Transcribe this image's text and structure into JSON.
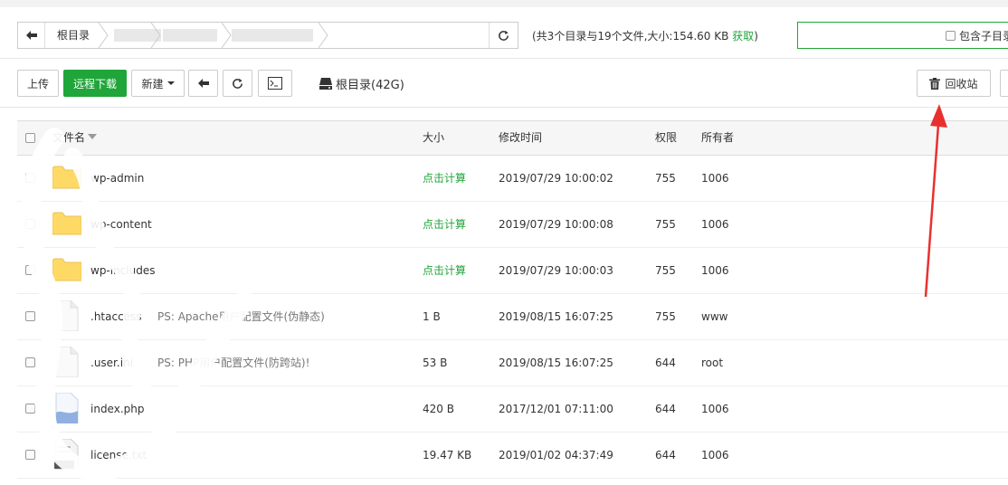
{
  "breadcrumb": {
    "root_label": "根目录"
  },
  "summary": {
    "text": "(共3个目录与19个文件,大小:154.60 KB ",
    "get_label": "获取",
    "close_paren": ")"
  },
  "search": {
    "include_sub_label": "包含子目录"
  },
  "toolbar": {
    "upload_label": "上传",
    "remote_download_label": "远程下载",
    "new_label": "新建",
    "disk_label": "根目录(42G)",
    "recycle_label": "回收站"
  },
  "table": {
    "columns": {
      "name": "文件名",
      "size": "大小",
      "mtime": "修改时间",
      "perm": "权限",
      "owner": "所有者"
    },
    "rows": [
      {
        "name": "wp-admin",
        "size": "点击计算",
        "mtime": "2019/07/29 10:00:02",
        "perm": "755",
        "owner": "1006",
        "type": "folder"
      },
      {
        "name": "wp-content",
        "size": "点击计算",
        "mtime": "2019/07/29 10:00:08",
        "perm": "755",
        "owner": "1006",
        "type": "folder"
      },
      {
        "name": "wp-includes",
        "size": "点击计算",
        "mtime": "2019/07/29 10:00:03",
        "perm": "755",
        "owner": "1006",
        "type": "folder"
      },
      {
        "name": ".htaccess",
        "note": "PS: Apache用户配置文件(伪静态)",
        "size": "1 B",
        "mtime": "2019/08/15 16:07:25",
        "perm": "755",
        "owner": "www",
        "type": "file"
      },
      {
        "name": ".user.ini",
        "note": "PS: PHP用户配置文件(防跨站)!",
        "size": "53 B",
        "mtime": "2019/08/15 16:07:25",
        "perm": "644",
        "owner": "root",
        "type": "file"
      },
      {
        "name": "index.php",
        "size": "420 B",
        "mtime": "2017/12/01 07:11:00",
        "perm": "644",
        "owner": "1006",
        "type": "php"
      },
      {
        "name": "license.txt",
        "size": "19.47 KB",
        "mtime": "2019/01/02 04:37:49",
        "perm": "644",
        "owner": "1006",
        "type": "txt"
      }
    ]
  },
  "icons": {
    "back": "arrow-left-icon",
    "refresh": "refresh-icon",
    "terminal": "terminal-icon",
    "disk": "hdd-icon",
    "trash": "trash-icon",
    "folder": "folder-icon",
    "file": "file-icon"
  },
  "colors": {
    "accent": "#20a53a",
    "arrow": "#e8312f",
    "folder": "#ffd966"
  }
}
